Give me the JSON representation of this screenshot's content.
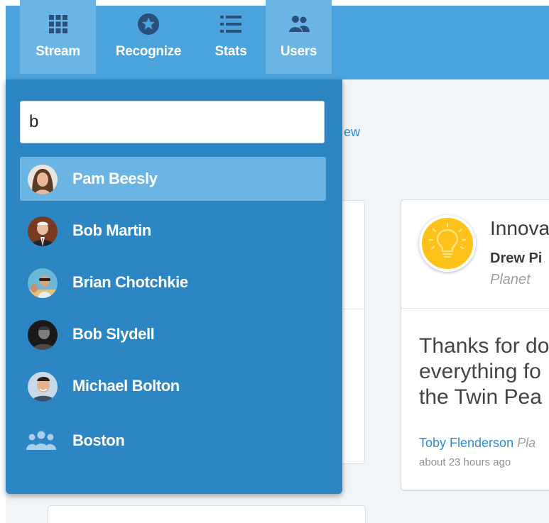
{
  "nav": {
    "items": [
      {
        "label": "Stream",
        "icon": "grid-icon",
        "active": true
      },
      {
        "label": "Recognize",
        "icon": "star-badge-icon",
        "active": false
      },
      {
        "label": "Stats",
        "icon": "list-icon",
        "active": false
      },
      {
        "label": "Users",
        "icon": "users-icon",
        "active": true
      }
    ]
  },
  "background": {
    "link_text": "ew"
  },
  "search": {
    "value": "b",
    "results": [
      {
        "label": "Pam Beesly",
        "highlighted": true
      },
      {
        "label": "Bob Martin",
        "highlighted": false
      },
      {
        "label": "Brian Chotchkie",
        "highlighted": false
      },
      {
        "label": "Bob Slydell",
        "highlighted": false
      },
      {
        "label": "Michael Bolton",
        "highlighted": false
      },
      {
        "label": "Boston",
        "highlighted": false,
        "type": "group"
      }
    ]
  },
  "card": {
    "badge_icon": "lightbulb-icon",
    "title": "Innova",
    "recipient": "Drew Pi",
    "team": "Planet",
    "message": "Thanks for do everything fo the Twin Pea",
    "author": "Toby Flenderson",
    "author_team": "Pla",
    "time": "about 23 hours ago"
  },
  "colors": {
    "nav_bg": "#4aa3dc",
    "dropdown_bg": "#2d86c4",
    "highlight_bg": "#6ab5e4",
    "badge": "#ffc21a",
    "link": "#2f8ad0"
  }
}
